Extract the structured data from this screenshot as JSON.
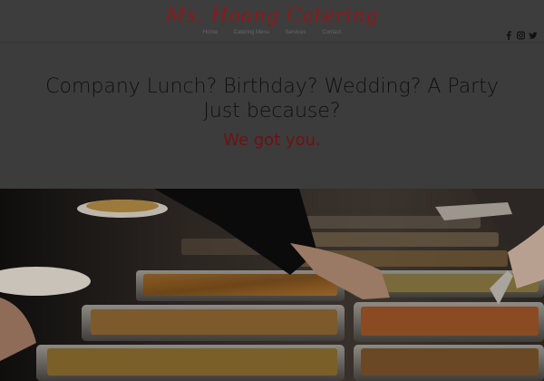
{
  "site": {
    "logo": "Ms. Hoang Catering",
    "nav": [
      "Home",
      "Catering Menu",
      "Services",
      "Contact"
    ]
  },
  "social": {
    "icons": [
      "facebook-icon",
      "instagram-icon",
      "twitter-icon"
    ]
  },
  "hero": {
    "headline": "Company Lunch? Birthday? Wedding? A Party Just because?",
    "tagline": "We got you."
  },
  "colors": {
    "logo": "#8a1a1a",
    "tagline": "#6e1212",
    "background": "#3c3c3c"
  }
}
